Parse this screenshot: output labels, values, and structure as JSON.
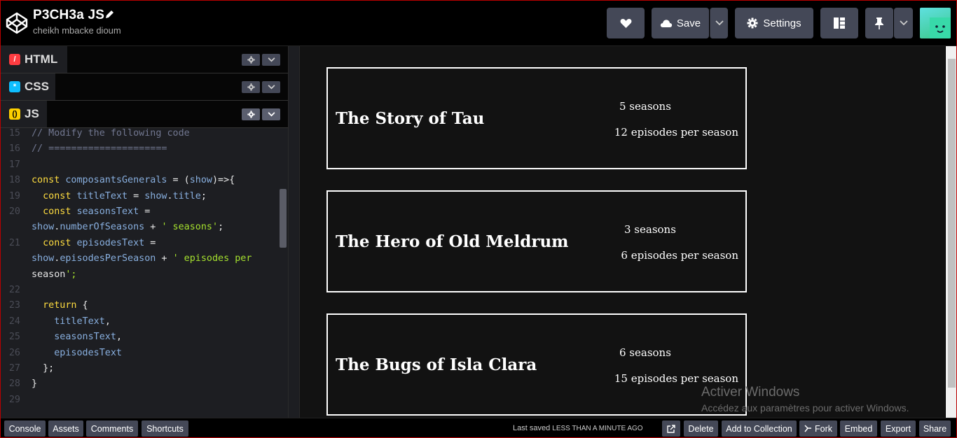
{
  "app": {
    "title": "P3CH3a JS",
    "author": "cheikh mbacke dioum"
  },
  "header": {
    "save_label": "Save",
    "settings_label": "Settings"
  },
  "panels": [
    {
      "label": "HTML",
      "icon": "html-icon",
      "color": "#ff3c41"
    },
    {
      "label": "CSS",
      "icon": "css-icon",
      "color": "#0ebeff"
    },
    {
      "label": "JS",
      "icon": "js-icon",
      "color": "#fcd000"
    }
  ],
  "code_lines": [
    {
      "n": "15",
      "text": "// Modify the following code"
    },
    {
      "n": "16",
      "text": "// ====================="
    },
    {
      "n": "17",
      "text": ""
    },
    {
      "n": "18",
      "text": "const composantsGenerals = (show)=>{"
    },
    {
      "n": "19",
      "text": "  const titleText = show.title;"
    },
    {
      "n": "20",
      "text": "  const seasonsText ="
    },
    {
      "n": "",
      "text": "show.numberOfSeasons + ' seasons';"
    },
    {
      "n": "21",
      "text": "  const episodesText ="
    },
    {
      "n": "",
      "text": "show.episodesPerSeason + ' episodes per"
    },
    {
      "n": "",
      "text": "season';"
    },
    {
      "n": "22",
      "text": ""
    },
    {
      "n": "23",
      "text": "  return {"
    },
    {
      "n": "24",
      "text": "    titleText,"
    },
    {
      "n": "25",
      "text": "    seasonsText,"
    },
    {
      "n": "26",
      "text": "    episodesText"
    },
    {
      "n": "27",
      "text": "  };"
    },
    {
      "n": "28",
      "text": "}"
    },
    {
      "n": "29",
      "text": ""
    }
  ],
  "shows": [
    {
      "title": "The Story of Tau",
      "seasons": "5 seasons",
      "episodes": "12 episodes per season"
    },
    {
      "title": "The Hero of Old Meldrum",
      "seasons": "3 seasons",
      "episodes": "6 episodes per season"
    },
    {
      "title": "The Bugs of Isla Clara",
      "seasons": "6 seasons",
      "episodes": "15 episodes per season"
    }
  ],
  "watermark": {
    "line1": "Activer Windows",
    "line2": "Accédez aux paramètres pour activer Windows."
  },
  "footer": {
    "buttons_left": [
      "Console",
      "Assets",
      "Comments",
      "Shortcuts"
    ],
    "saved_prefix": "Last saved",
    "saved_time": "LESS THAN A MINUTE AGO",
    "buttons_right": [
      "Delete",
      "Add to Collection",
      "Fork",
      "Embed",
      "Export",
      "Share"
    ]
  }
}
